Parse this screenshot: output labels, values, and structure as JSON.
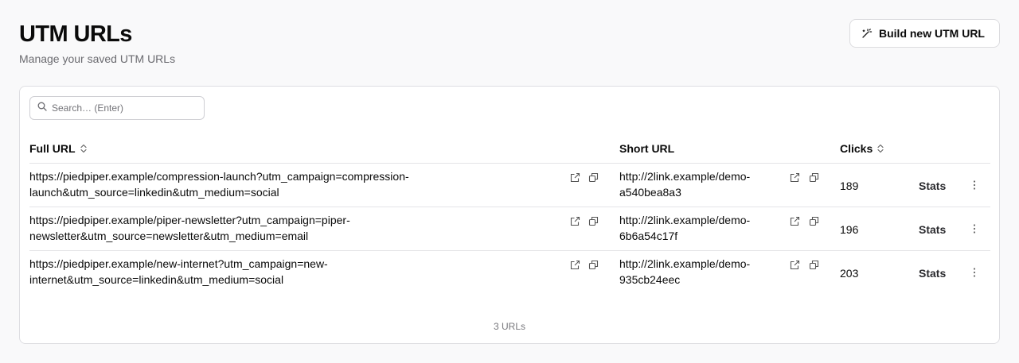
{
  "header": {
    "title": "UTM URLs",
    "subtitle": "Manage your saved UTM URLs",
    "build_button_label": "Build new UTM URL",
    "build_button_icon": "magic-wand-icon"
  },
  "search": {
    "placeholder": "Search… (Enter)",
    "value": ""
  },
  "table": {
    "columns": {
      "full_url": "Full URL",
      "short_url": "Short URL",
      "clicks": "Clicks"
    },
    "rows": [
      {
        "full_url_line1": "https://piedpiper.example/compression-launch?utm_campaign=compression-",
        "full_url_line2": "launch&utm_source=linkedin&utm_medium=social",
        "short_url_line1": "http://2link.example/demo-",
        "short_url_line2": "a540bea8a3",
        "clicks": "189",
        "stats_label": "Stats"
      },
      {
        "full_url_line1": "https://piedpiper.example/piper-newsletter?utm_campaign=piper-",
        "full_url_line2": "newsletter&utm_source=newsletter&utm_medium=email",
        "short_url_line1": "http://2link.example/demo-",
        "short_url_line2": "6b6a54c17f",
        "clicks": "196",
        "stats_label": "Stats"
      },
      {
        "full_url_line1": "https://piedpiper.example/new-internet?utm_campaign=new-",
        "full_url_line2": "internet&utm_source=linkedin&utm_medium=social",
        "short_url_line1": "http://2link.example/demo-",
        "short_url_line2": "935cb24eec",
        "clicks": "203",
        "stats_label": "Stats"
      }
    ]
  },
  "footer": {
    "count_label": "3 URLs"
  }
}
